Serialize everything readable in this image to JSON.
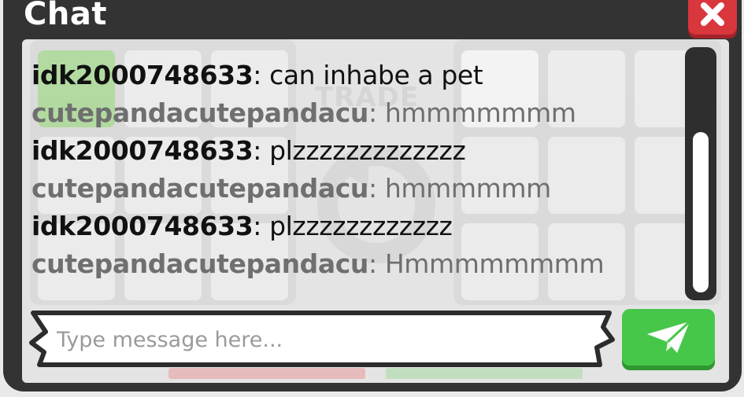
{
  "window": {
    "title": "Chat",
    "close_icon": "close-x-icon"
  },
  "background": {
    "trade_label": "TRADE"
  },
  "chat": {
    "messages": [
      {
        "user": "idk2000748633",
        "separator": ":",
        "text": " can inhabe a pet",
        "style": "self"
      },
      {
        "user": "cutepandacutepandacu",
        "separator": ":",
        "text": " hmmmmmmm",
        "style": "other"
      },
      {
        "user": "idk2000748633",
        "separator": ":",
        "text": " plzzzzzzzzzzzzz",
        "style": "self"
      },
      {
        "user": "cutepandacutepandacu",
        "separator": ":",
        "text": " hmmmmmm",
        "style": "other"
      },
      {
        "user": "idk2000748633",
        "separator": ":",
        "text": " plzzzzzzzzzzzz",
        "style": "self"
      },
      {
        "user": "cutepandacutepandacu",
        "separator": ":",
        "text": " Hmmmmmmmm",
        "style": "other"
      }
    ]
  },
  "input": {
    "placeholder": "Type message here...",
    "value": ""
  },
  "send_button": {
    "icon": "paper-plane-icon"
  },
  "colors": {
    "frame": "#333333",
    "close": "#d9363e",
    "send": "#47c74a",
    "self_text": "#111111",
    "other_text": "#6f6f6f"
  }
}
